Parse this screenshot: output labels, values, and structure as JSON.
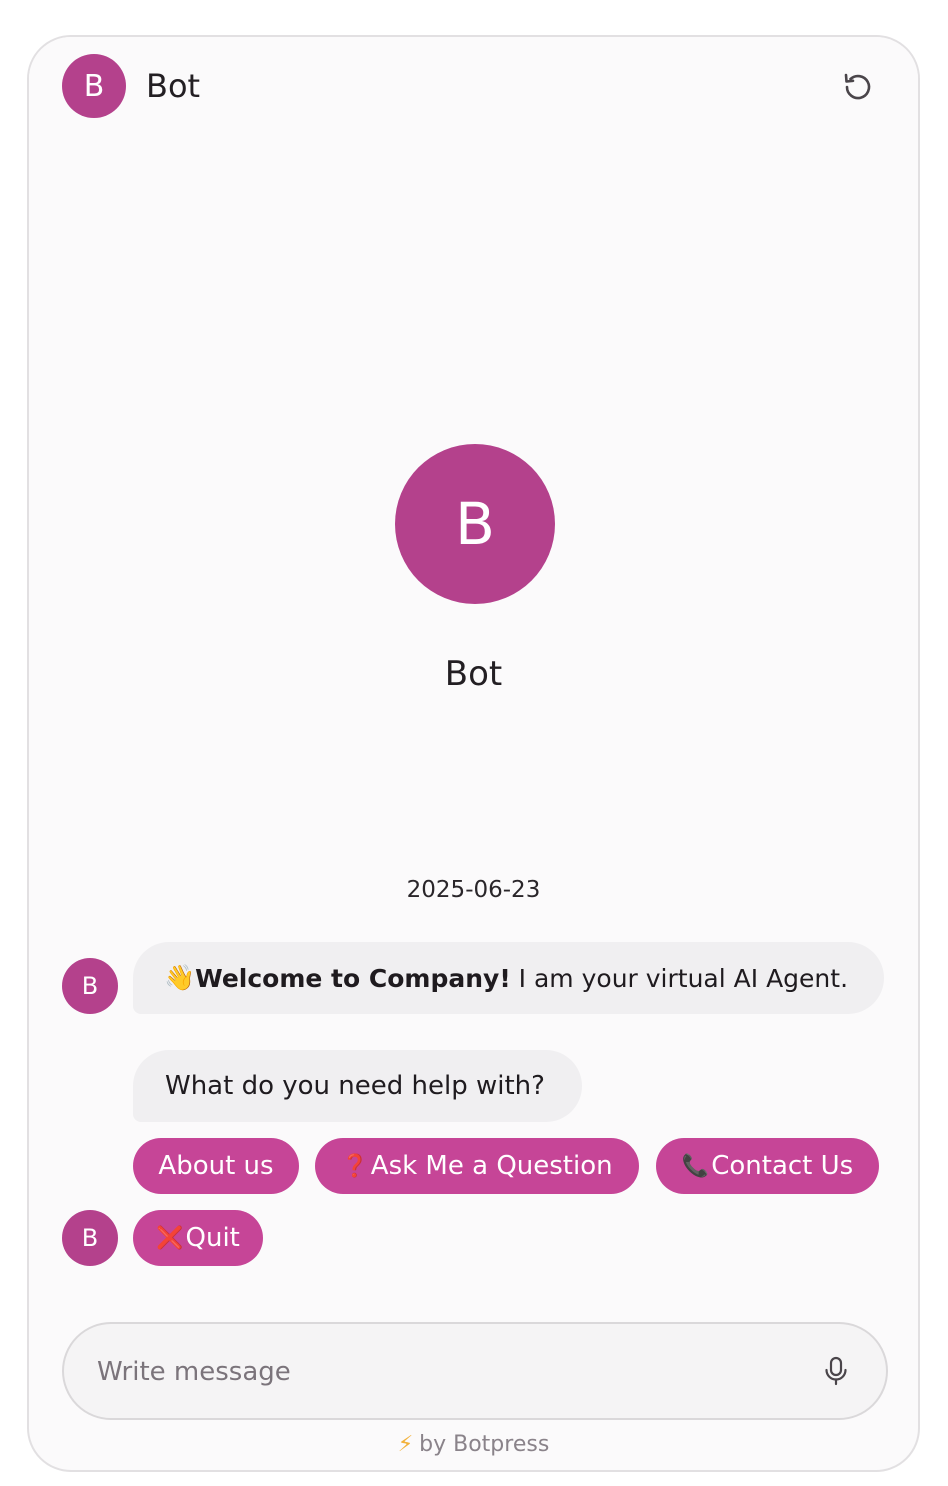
{
  "header": {
    "avatar_initial": "B",
    "bot_name": "Bot",
    "restart_icon": "restart-icon"
  },
  "hero": {
    "avatar_initial": "B",
    "bot_name": "Bot"
  },
  "conversation": {
    "date": "2025-06-23",
    "messages": [
      {
        "emoji": "👋",
        "bold": "Welcome to Company!",
        "text": " I am your virtual AI Agent."
      },
      {
        "text": "What do you need help with?"
      }
    ],
    "avatar_initial": "B",
    "choices": [
      {
        "emoji": "",
        "label": "About us"
      },
      {
        "emoji": "❓",
        "label": "Ask Me a Question"
      },
      {
        "emoji": "📞",
        "label": "Contact Us"
      },
      {
        "emoji": "❌",
        "label": "Quit"
      }
    ]
  },
  "composer": {
    "placeholder": "Write message",
    "mic_icon": "microphone-icon"
  },
  "footer": {
    "bolt": "⚡",
    "text": "by Botpress"
  },
  "colors": {
    "accent": "#c64597",
    "avatar": "#b4418c",
    "bubble": "#f0eff1",
    "panel": "#fbfafb"
  }
}
